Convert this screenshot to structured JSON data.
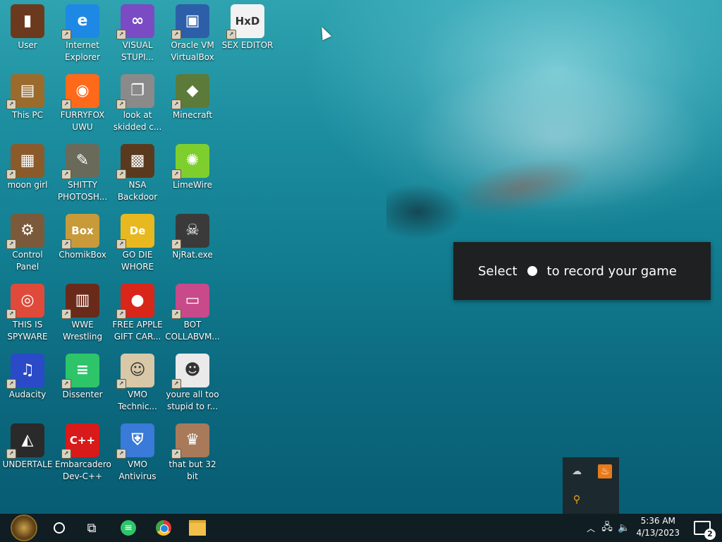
{
  "desktop": {
    "icons": [
      {
        "label": "User",
        "glyph": "▮",
        "bg": "#6b3a1e"
      },
      {
        "label": "Internet Explorer",
        "glyph": "e",
        "bg": "#1e88e5"
      },
      {
        "label": "VISUAL STUPI...",
        "glyph": "∞",
        "bg": "#7b4bc4"
      },
      {
        "label": "Oracle VM VirtualBox",
        "glyph": "▣",
        "bg": "#2d5fa8"
      },
      {
        "label": "SEX EDITOR",
        "glyph": "HxD",
        "bg": "#f2f2f2"
      },
      {
        "label": "This PC",
        "glyph": "▤",
        "bg": "#9a6b2c"
      },
      {
        "label": "FURRYFOX UWU",
        "glyph": "◉",
        "bg": "#ff6a1a"
      },
      {
        "label": "look at skidded c...",
        "glyph": "❐",
        "bg": "#8a8a8a"
      },
      {
        "label": "Minecraft",
        "glyph": "◆",
        "bg": "#5c7a3a"
      },
      {
        "label": "moon girl",
        "glyph": "▦",
        "bg": "#8a5a2a"
      },
      {
        "label": "SHITTY PHOTOSH...",
        "glyph": "✎",
        "bg": "#6a6a5a"
      },
      {
        "label": "NSA Backdoor",
        "glyph": "▩",
        "bg": "#5a3a1e"
      },
      {
        "label": "LimeWire",
        "glyph": "✺",
        "bg": "#7ecf2e"
      },
      {
        "label": "Control Panel",
        "glyph": "⚙",
        "bg": "#7a5a3a"
      },
      {
        "label": "ChomikBox",
        "glyph": "Box",
        "bg": "#c89a3a"
      },
      {
        "label": "GO DIE WHORE",
        "glyph": "De",
        "bg": "#e8b820"
      },
      {
        "label": "NjRat.exe",
        "glyph": "☠",
        "bg": "#3a3a3a"
      },
      {
        "label": "THIS IS SPYWARE",
        "glyph": "◎",
        "bg": "#e04a3a"
      },
      {
        "label": "WWE Wrestling",
        "glyph": "▥",
        "bg": "#6a2a1a"
      },
      {
        "label": "FREE APPLE GIFT CAR...",
        "glyph": "●",
        "bg": "#d8261a"
      },
      {
        "label": "BOT COLLABVM...",
        "glyph": "▭",
        "bg": "#c84a8a"
      },
      {
        "label": "Audacity",
        "glyph": "♫",
        "bg": "#2a4ac8"
      },
      {
        "label": "Dissenter",
        "glyph": "≡",
        "bg": "#2ec46a"
      },
      {
        "label": "VMO Technic...",
        "glyph": "☺",
        "bg": "#d8c8a8"
      },
      {
        "label": "youre all too stupid to r...",
        "glyph": "☻",
        "bg": "#eaeaea"
      },
      {
        "label": "UNDERTALE",
        "glyph": "◭",
        "bg": "#2a2a2a"
      },
      {
        "label": "Embarcadero Dev-C++",
        "glyph": "C++",
        "bg": "#d81a1a"
      },
      {
        "label": "VMO Antivirus",
        "glyph": "⛨",
        "bg": "#3a7ad8"
      },
      {
        "label": "that but 32 bit",
        "glyph": "♛",
        "bg": "#a87a5a"
      }
    ]
  },
  "gamebar": {
    "before": "Select",
    "after": "to record your game"
  },
  "tray": {
    "flyout": [
      "cloud-off-icon",
      "java-icon",
      "search-tray-icon"
    ]
  },
  "taskbar": {
    "time": "5:36 AM",
    "date": "4/13/2023",
    "notifications": "2"
  }
}
